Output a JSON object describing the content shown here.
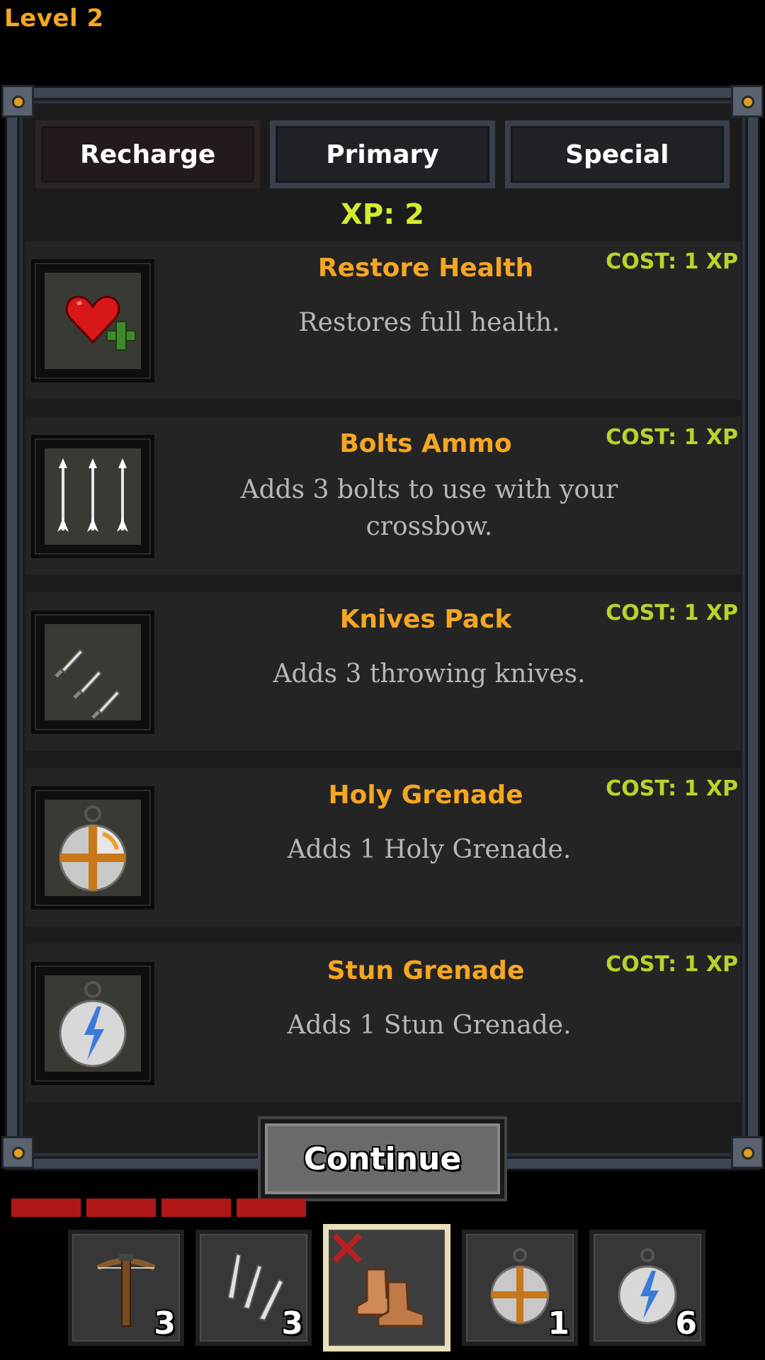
{
  "hud": {
    "level": "Level 2"
  },
  "tabs": [
    {
      "label": "Recharge",
      "active": true
    },
    {
      "label": "Primary",
      "active": false
    },
    {
      "label": "Special",
      "active": false
    }
  ],
  "xp_total": "XP: 2",
  "items": [
    {
      "title": "Restore Health",
      "cost": "COST: 1 XP",
      "desc": "Restores full health.",
      "icon": "heart-plus-icon"
    },
    {
      "title": "Bolts Ammo",
      "cost": "COST: 1 XP",
      "desc": "Adds 3 bolts to use with your crossbow.",
      "icon": "bolts-icon"
    },
    {
      "title": "Knives Pack",
      "cost": "COST: 1 XP",
      "desc": "Adds 3 throwing knives.",
      "icon": "knives-icon"
    },
    {
      "title": "Holy Grenade",
      "cost": "COST: 1 XP",
      "desc": "Adds 1 Holy Grenade.",
      "icon": "holy-grenade-icon"
    },
    {
      "title": "Stun Grenade",
      "cost": "COST: 1 XP",
      "desc": "Adds 1 Stun Grenade.",
      "icon": "stun-grenade-icon"
    }
  ],
  "continue_label": "Continue",
  "health": {
    "segments_filled": 4
  },
  "hotbar": [
    {
      "icon": "crossbow-icon",
      "count": "3",
      "selected": false
    },
    {
      "icon": "knives-icon",
      "count": "3",
      "selected": false
    },
    {
      "icon": "boots-icon",
      "count": "",
      "selected": true
    },
    {
      "icon": "holy-grenade-icon",
      "count": "1",
      "selected": false
    },
    {
      "icon": "stun-grenade-icon",
      "count": "6",
      "selected": false
    }
  ],
  "colors": {
    "accent": "#f5a623",
    "xp": "#d4ec2a",
    "cost": "#b8d42a",
    "health": "#b01818"
  }
}
